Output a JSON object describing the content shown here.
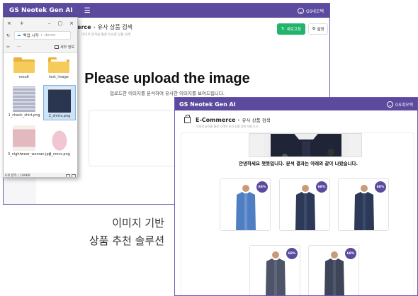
{
  "app": {
    "brand": "GS Neotek Gen AI",
    "menu_icon": "hamburger-icon",
    "user_label": "GS네오텍"
  },
  "back_window": {
    "breadcrumb_main": "Commerce",
    "breadcrumb_arrow": "›",
    "breadcrumb_sub": "유사 상품 검색",
    "breadcrumb_desc": "이미지 분석을 통한 유사한 상품 검색",
    "btn_new": "새로고침",
    "btn_settings": "설정",
    "upload_title": "Please upload the image",
    "upload_subtitle": "업로드한 이미지를 분석하여 유사한 이미지를 보여드립니다."
  },
  "explorer": {
    "tab_close": "×",
    "tab_plus": "+",
    "win_min": "–",
    "win_max": "▢",
    "win_close": "×",
    "nav_refresh": "↻",
    "address_label": "백업 시작",
    "address_sep": "›",
    "address_tail": "demo",
    "toolbar_cut": "✂",
    "toolbar_more": "···",
    "new_window": "세부 정보",
    "files": [
      {
        "name": "result",
        "type": "folder"
      },
      {
        "name": "test_image",
        "type": "folder"
      },
      {
        "name": "1_check_shirt.png",
        "type": "image",
        "color": "#d9dbe6"
      },
      {
        "name": "2_shirts.png",
        "type": "image",
        "color": "#2a3550",
        "selected": true
      },
      {
        "name": "3_nightwear_woman.jpg",
        "type": "image",
        "color": "#e3b9c0"
      },
      {
        "name": "4_crocs.png",
        "type": "image",
        "color": "#f1c6d2"
      }
    ],
    "status": "6개 항목 | 189KB"
  },
  "caption": {
    "line1": "이미지 기반",
    "line2": "상품 추천 솔루션"
  },
  "front_window": {
    "breadcrumb_main": "E-Commerce",
    "breadcrumb_arrow": "›",
    "breadcrumb_sub": "유사 상품 검색",
    "breadcrumb_desc": "이미지 분석을 통한 고객의 유사 상품 검색 지원 도구",
    "result_message": "안녕하세요 챗봇입니다. 분석 결과는 아래와 같이 나왔습니다.",
    "results": [
      {
        "badge": "68%",
        "shirt": "#4f7fc2"
      },
      {
        "badge": "68%",
        "shirt": "#2c3957"
      },
      {
        "badge": "68%",
        "shirt": "#2c3957"
      },
      {
        "badge": "68%",
        "shirt": "#4d5468"
      },
      {
        "badge": "68%",
        "shirt": "#3e4558"
      }
    ]
  },
  "colors": {
    "brand": "#5b4a9e",
    "accent_green": "#22b46b"
  }
}
